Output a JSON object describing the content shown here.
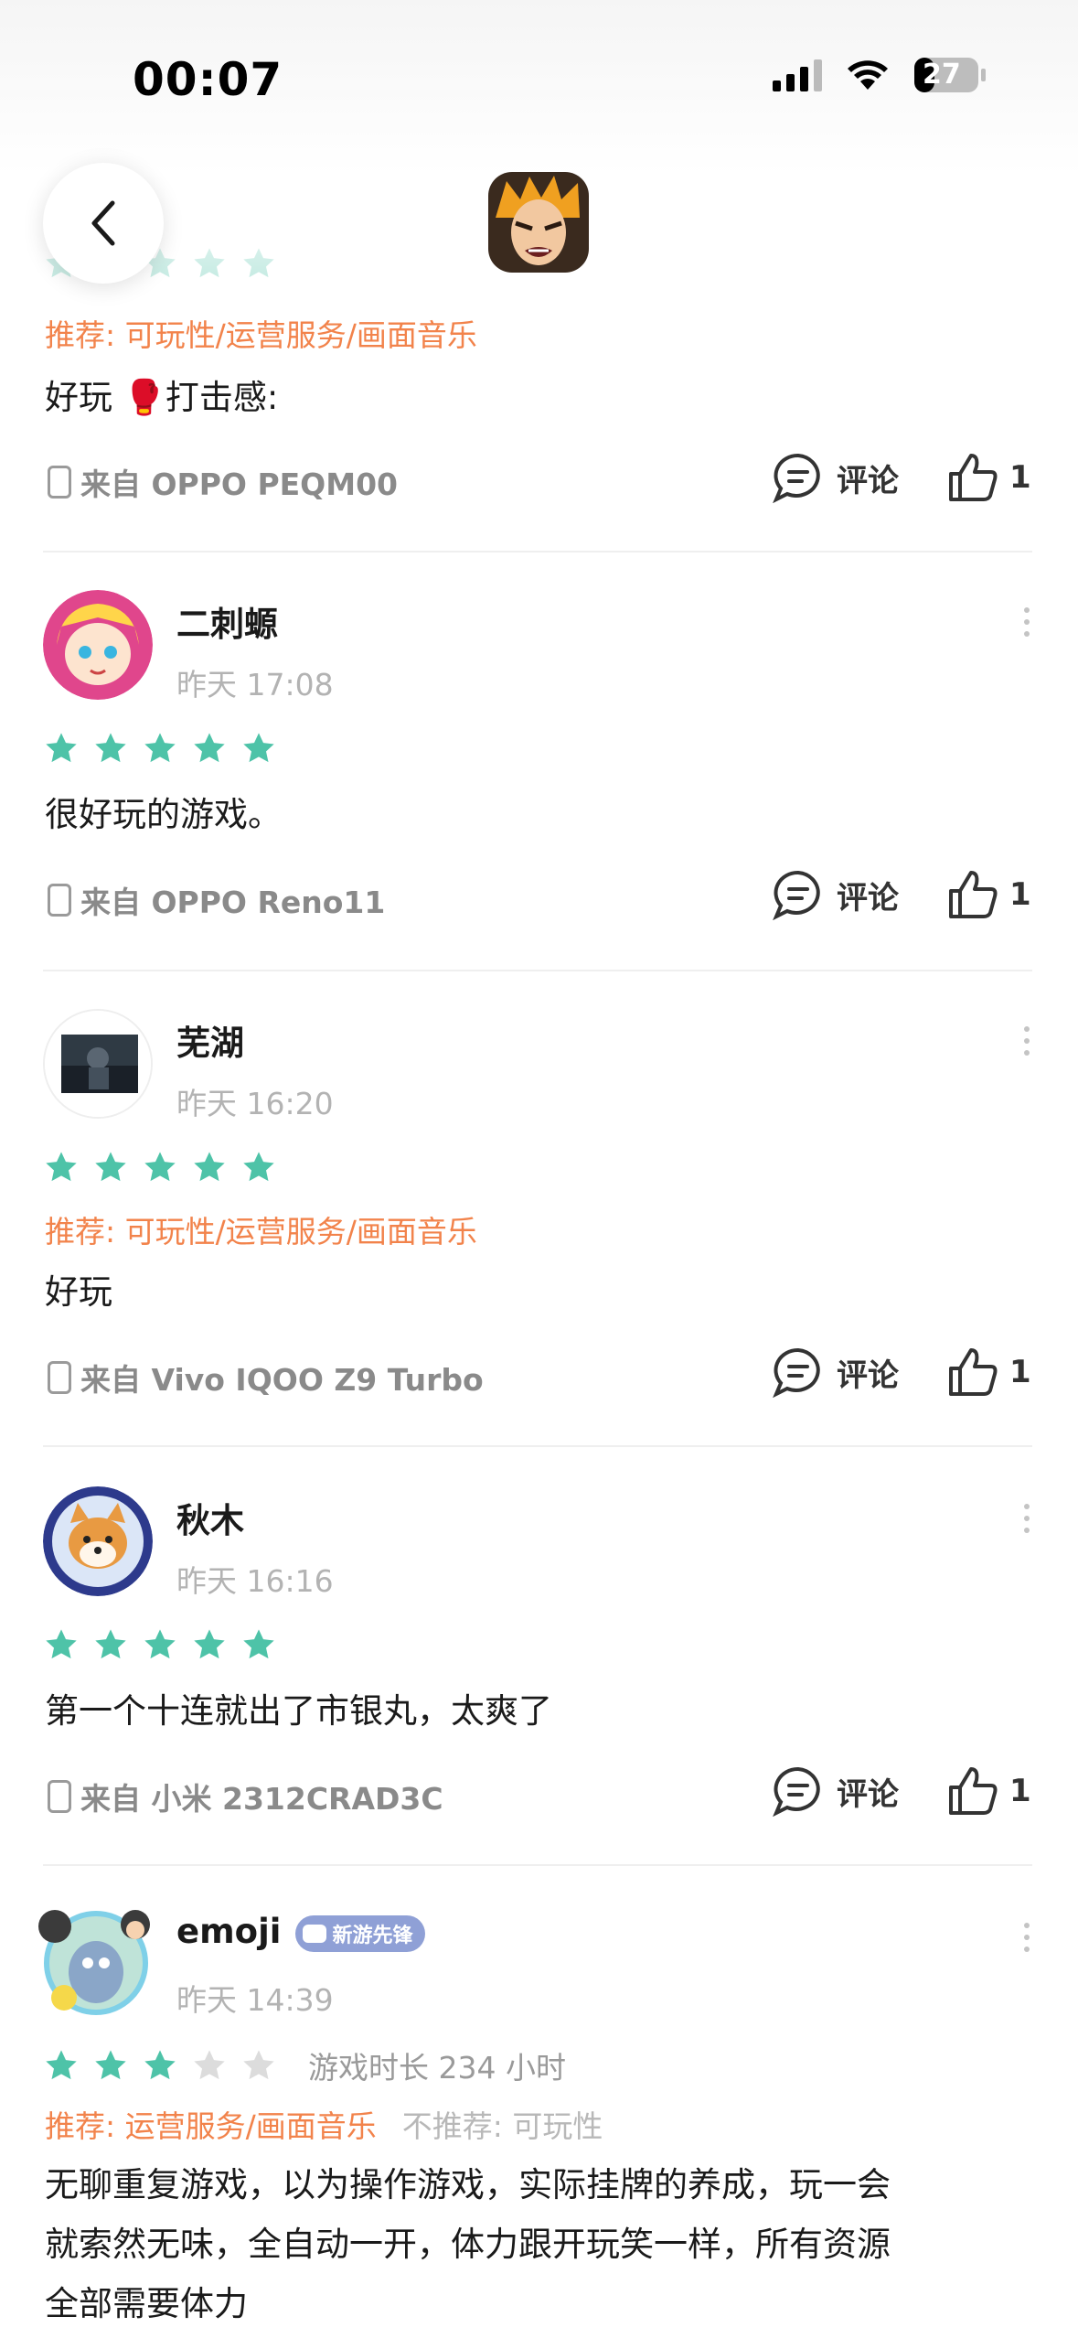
{
  "status_bar": {
    "time": "00:07",
    "battery": "27"
  },
  "header": {
    "app_icon": "bleach-game-icon"
  },
  "first_review_partial": {
    "recommend": "推荐: 可玩性/运营服务/画面音乐",
    "text": "好玩 🥊打击感:",
    "device": "来自 OPPO PEQM00",
    "comment_label": "评论",
    "likes": "1",
    "rating": 5
  },
  "reviews": [
    {
      "name": "二刺螈",
      "time": "昨天 17:08",
      "rating": 5,
      "recommend": "",
      "text": "很好玩的游戏。",
      "device": "来自 OPPO Reno11",
      "comment_label": "评论",
      "likes": "1"
    },
    {
      "name": "芜湖",
      "time": "昨天 16:20",
      "rating": 5,
      "recommend": "推荐: 可玩性/运营服务/画面音乐",
      "text": "好玩",
      "device": "来自 Vivo IQOO Z9 Turbo",
      "comment_label": "评论",
      "likes": "1"
    },
    {
      "name": "秋木",
      "time": "昨天 16:16",
      "rating": 5,
      "recommend": "",
      "text": "第一个十连就出了市银丸，太爽了",
      "device": "来自 小米 2312CRAD3C",
      "comment_label": "评论",
      "likes": "1"
    },
    {
      "name": "emoji",
      "badge": "新游先锋",
      "time": "昨天 14:39",
      "rating": 3,
      "playtime": "游戏时长 234 小时",
      "recommend": "推荐: 运营服务/画面音乐",
      "not_recommend": "不推荐: 可玩性",
      "text_lines": [
        "无聊重复游戏，以为操作游戏，实际挂牌的养成，玩一会",
        "就索然无味，全自动一开，体力跟开玩笑一样，所有资源",
        "全部需要体力"
      ]
    }
  ],
  "colors": {
    "star": "#4ec3a8",
    "star_empty": "#dcdcdc",
    "recommend": "#f2834b"
  }
}
